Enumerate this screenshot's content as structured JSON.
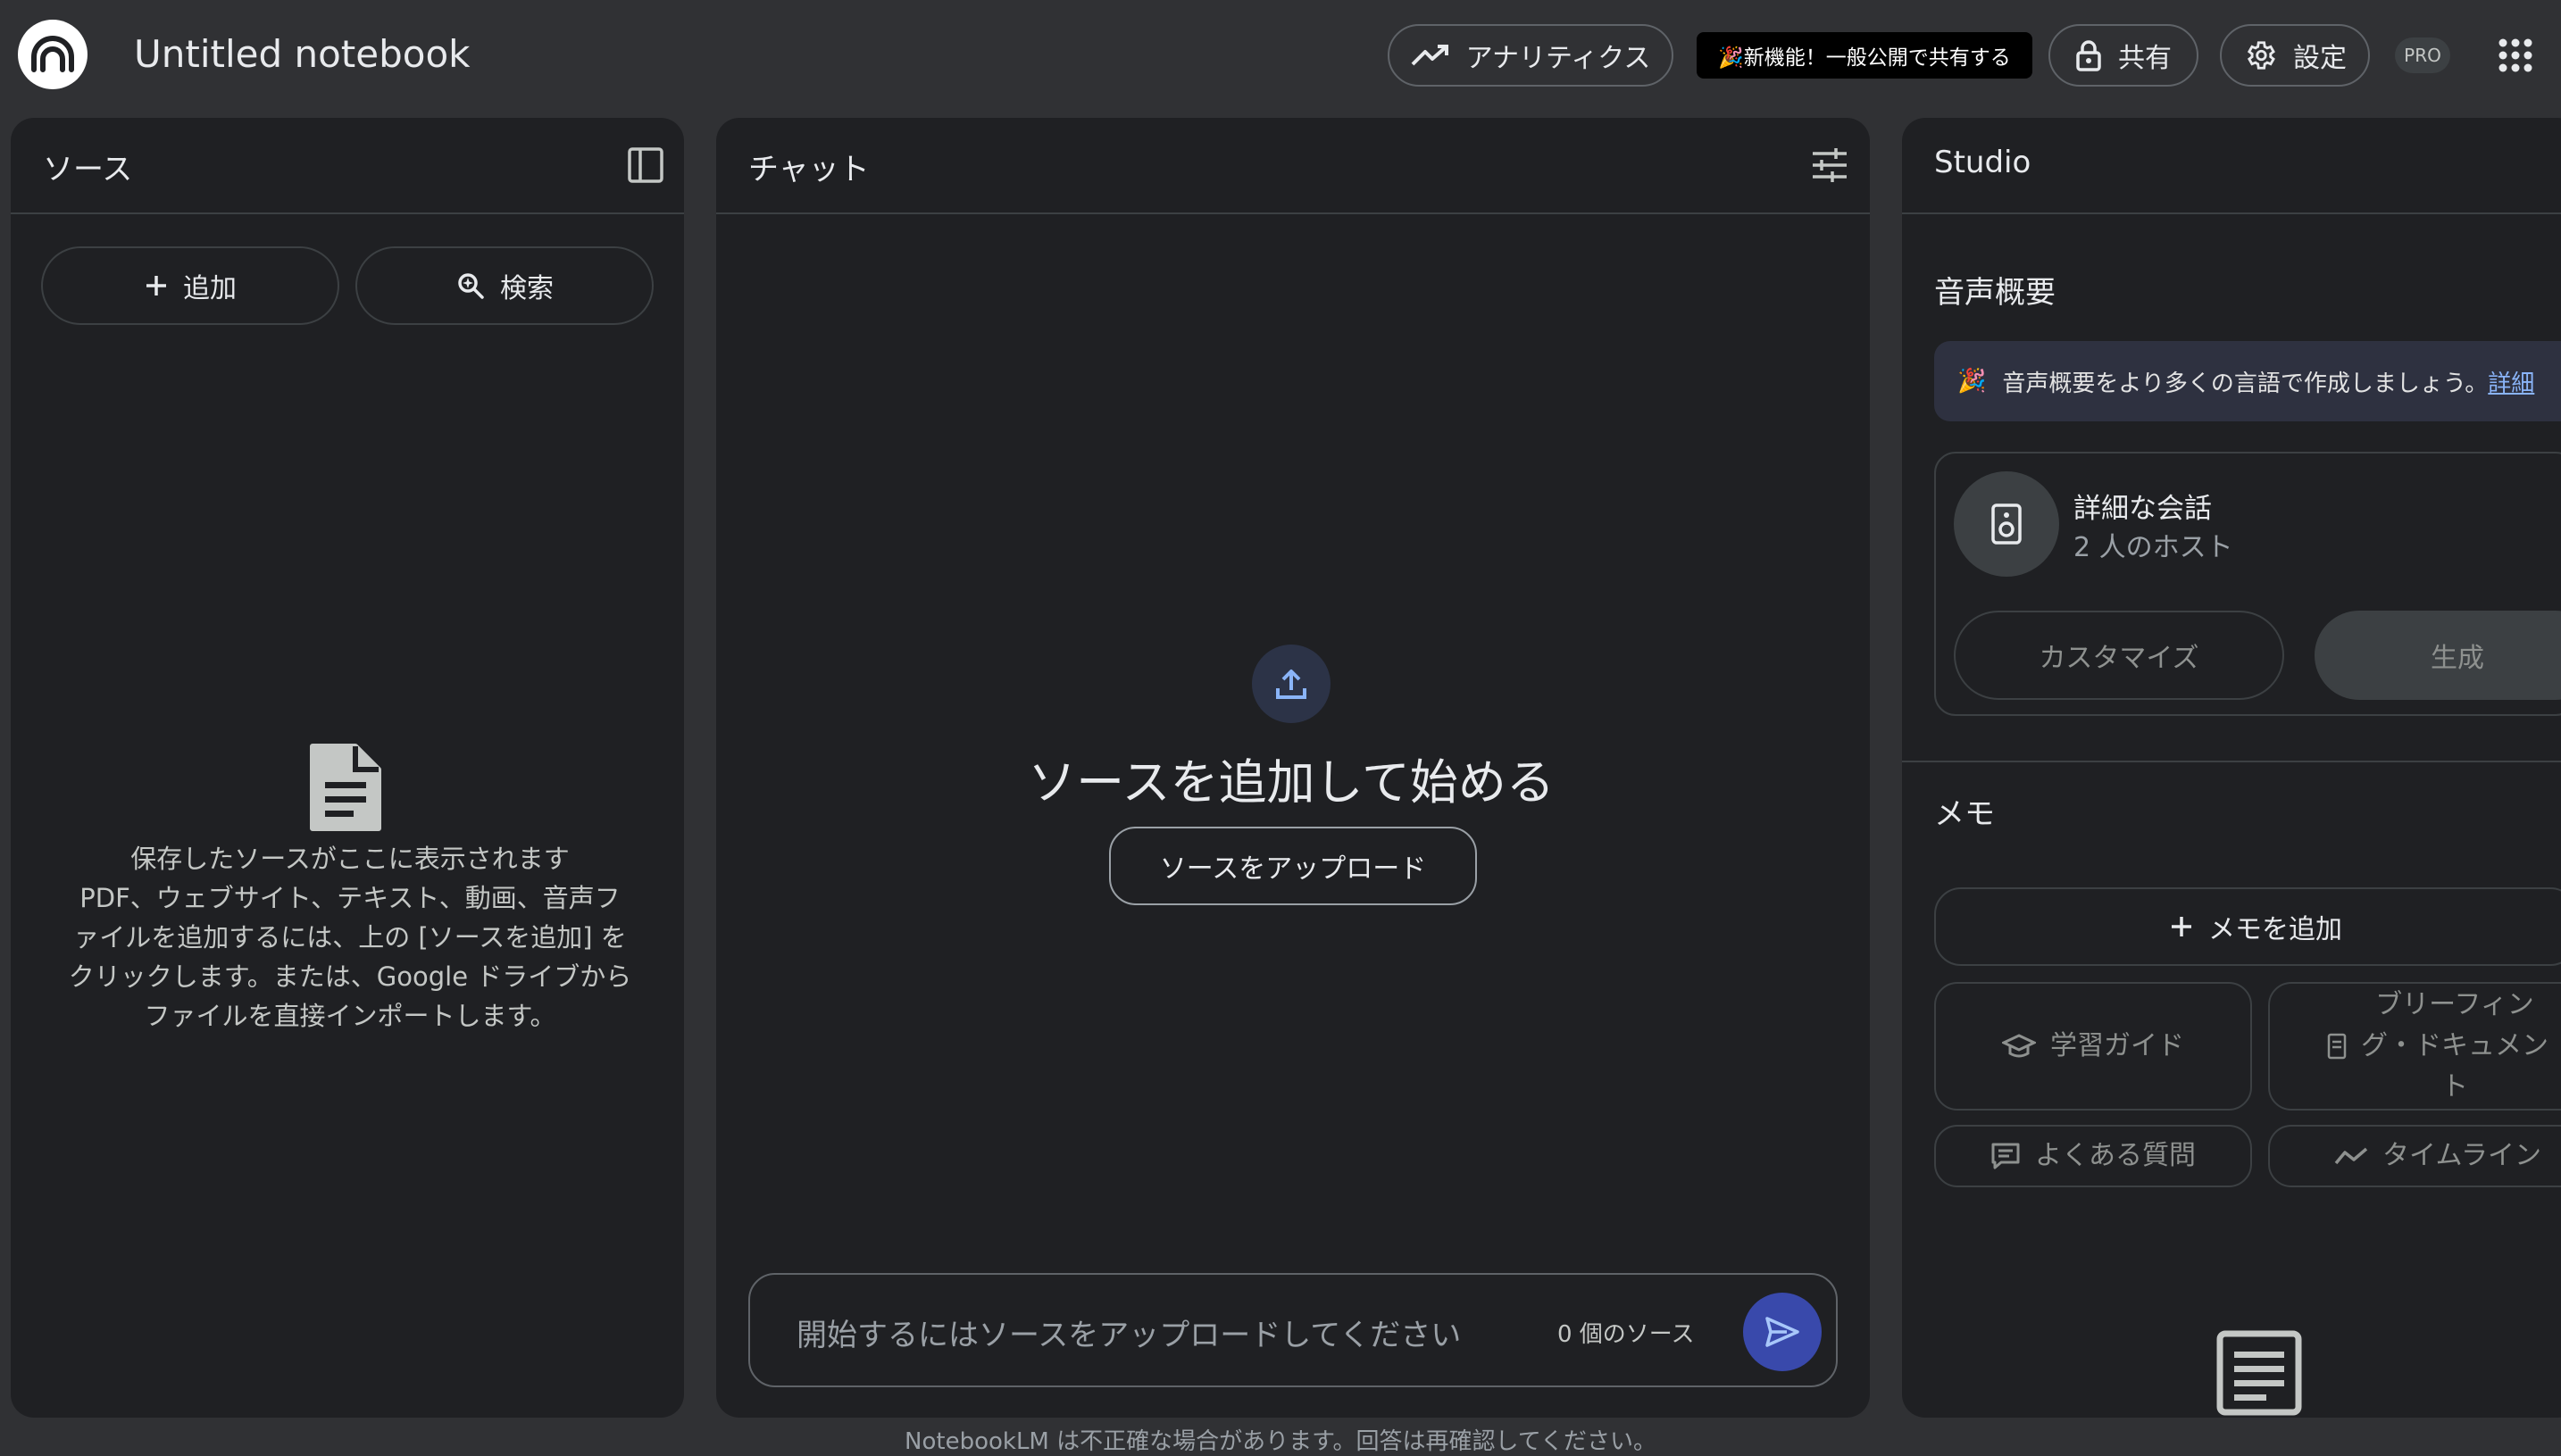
{
  "header": {
    "notebook_title": "Untitled notebook",
    "analytics_label": "アナリティクス",
    "new_feature_label": "🎉新機能！一般公開で共有する",
    "share_label": "共有",
    "settings_label": "設定",
    "pro_badge": "PRO"
  },
  "sources": {
    "title": "ソース",
    "add_label": "追加",
    "search_label": "検索",
    "empty_lines": [
      "保存したソースがここに表示されます",
      "PDF、ウェブサイト、テキスト、動画、音声フ",
      "ァイルを追加するには、上の [ソースを追加] を",
      "クリックします。または、Google ドライブから",
      "ファイルを直接インポートします。"
    ]
  },
  "chat": {
    "title": "チャット",
    "headline": "ソースを追加して始める",
    "upload_button": "ソースをアップロード",
    "input_placeholder": "開始するにはソースをアップロードしてください",
    "source_count": "0 個のソース"
  },
  "studio": {
    "title": "Studio",
    "audio_heading": "音声概要",
    "banner_text": "音声概要をより多くの言語で作成しましょう。",
    "banner_link": "詳細",
    "card_title": "詳細な会話",
    "card_subtitle": "2 人のホスト",
    "customize_label": "カスタマイズ",
    "generate_label": "生成",
    "memo_heading": "メモ",
    "add_memo_label": "メモを追加",
    "study_guide_label": "学習ガイド",
    "briefing_lines": [
      "ブリーフィン",
      "グ・ドキュメン",
      "ト"
    ],
    "faq_label": "よくある質問",
    "timeline_label": "タイムライン"
  },
  "footer": {
    "disclaimer": "NotebookLM は不正確な場合があります。回答は再確認してください。"
  },
  "colors": {
    "background": "#303134",
    "panel": "#1f2023",
    "accent": "#3949ab",
    "upload_icon": "#8ab4f8"
  }
}
